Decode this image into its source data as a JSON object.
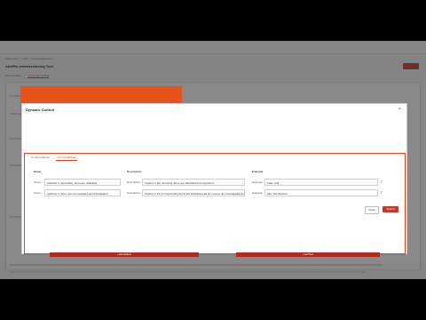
{
  "background": {
    "crumb": "Observation > AMC > Rule/Engagement",
    "title": "Add/Re-commissioning Tool",
    "action_label": "Save",
    "tabs": [
      "Basic Details",
      "Consumer Details"
    ],
    "footer": "1/1"
  },
  "dialog": {
    "title": "Dynamic Control",
    "close_symbol": "×",
    "tabs": [
      "Control Adjuster",
      "Control Attribute"
    ],
    "columns": {
      "name": "Name",
      "description": "Description",
      "example": "Example"
    },
    "rows": [
      {
        "name_label": "Name",
        "name": "Attribute 1: Recording, items are classified",
        "description_label": "Description",
        "description": "Capture if the recording items are classified and supported",
        "example_label": "Example",
        "example": "Pass, Fail"
      },
      {
        "name_label": "Name",
        "name": "Attribute 2: Items are not classified and investigated",
        "description_label": "Description",
        "description": "Capture if the corresponding items are classified and any issues are investigated and resolved",
        "example_label": "Example",
        "example": "Met, Not Needed"
      }
    ],
    "add_attribute_label": "+ Add Attribute",
    "add_row_label": "+ Add Row",
    "close_label": "Close",
    "submit_label": "Submit"
  }
}
